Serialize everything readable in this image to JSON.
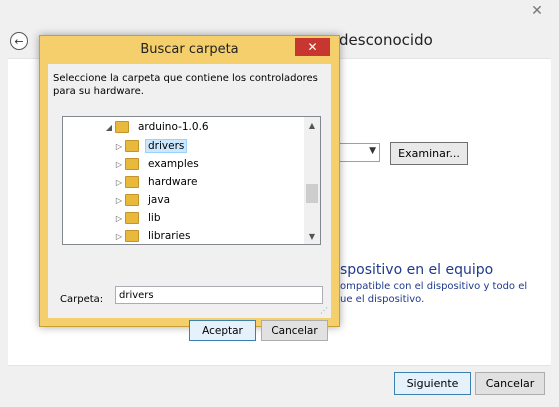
{
  "background": {
    "title": "desconocido",
    "browse_label": "Examinar...",
    "heading": "spositivo en el equipo",
    "desc_line1": "ompatible con el dispositivo y todo el",
    "desc_line2": "ue el dispositivo.",
    "next_label": "Siguiente",
    "cancel_label": "Cancelar"
  },
  "dialog": {
    "title": "Buscar carpeta",
    "close_glyph": "✕",
    "prompt": "Seleccione la carpeta que contiene los controladores para su hardware.",
    "tree": [
      {
        "label": "arduino-1.0.6",
        "expander": "◢",
        "selected": false
      },
      {
        "label": "drivers",
        "expander": "▷",
        "selected": true
      },
      {
        "label": "examples",
        "expander": "▷",
        "selected": false
      },
      {
        "label": "hardware",
        "expander": "▷",
        "selected": false
      },
      {
        "label": "java",
        "expander": "▷",
        "selected": false
      },
      {
        "label": "lib",
        "expander": "▷",
        "selected": false
      },
      {
        "label": "libraries",
        "expander": "▷",
        "selected": false
      }
    ],
    "folder_label": "Carpeta:",
    "folder_value": "drivers",
    "ok_label": "Aceptar",
    "cancel_label": "Cancelar"
  },
  "colors": {
    "dialog_frame": "#f5cf6b",
    "close_button": "#c7372f",
    "selection": "#cce8ff",
    "link_text": "#1e3a8c"
  }
}
